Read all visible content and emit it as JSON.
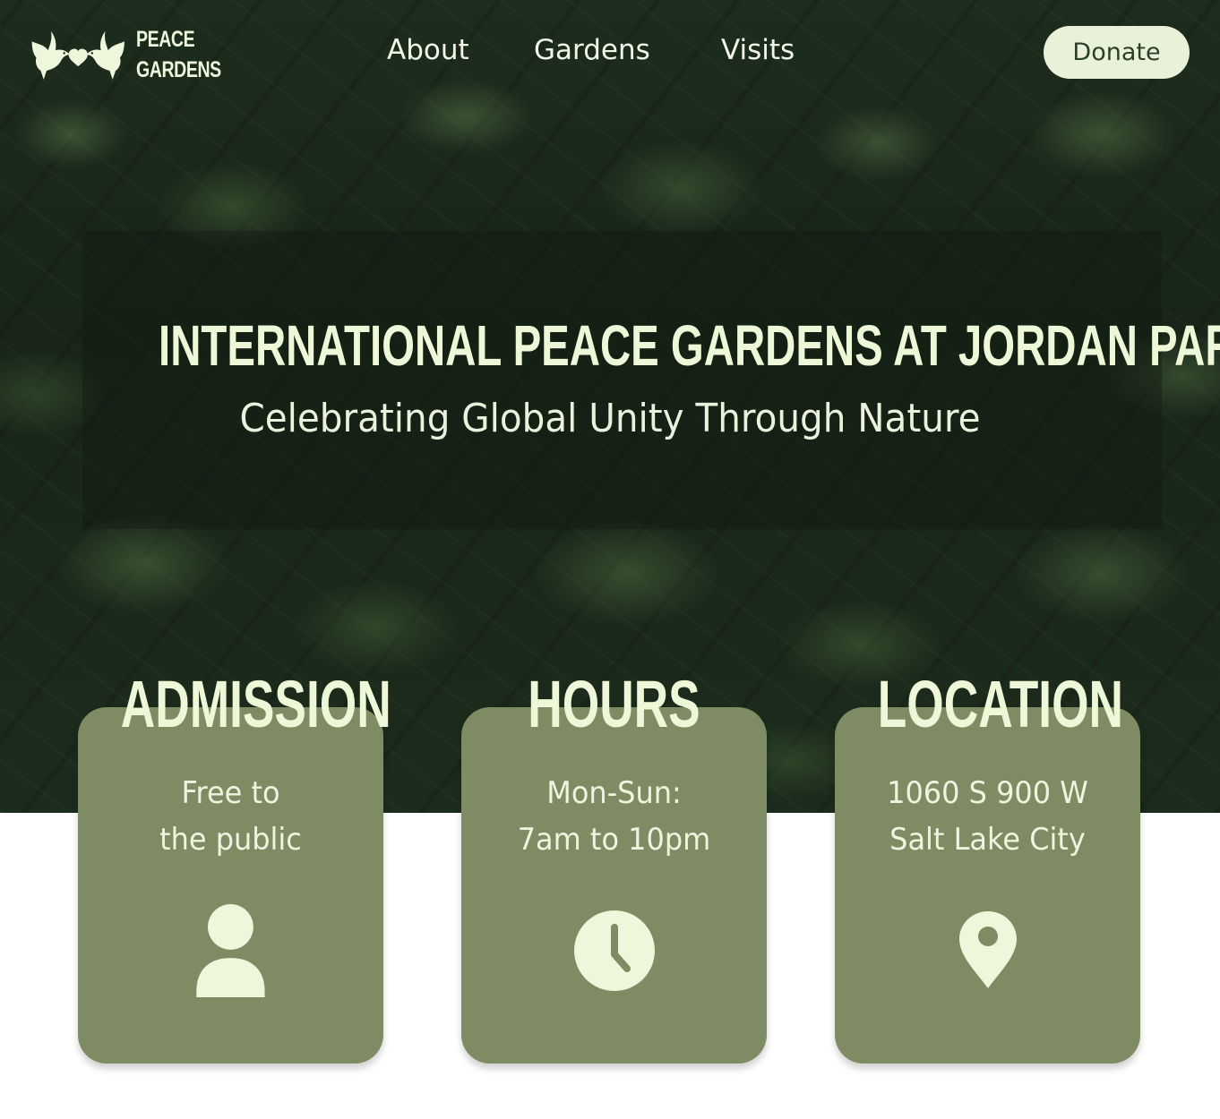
{
  "brand": {
    "logo_line1": "PEACE",
    "logo_line2": "GARDENS",
    "logo_icon": "two-doves-heart-icon"
  },
  "nav": {
    "items": [
      {
        "label": "About"
      },
      {
        "label": "Gardens"
      },
      {
        "label": "Visits"
      }
    ],
    "donate_label": "Donate"
  },
  "hero": {
    "title": "INTERNATIONAL PEACE GARDENS AT JORDAN PARK",
    "subtitle": "Celebrating Global Unity Through Nature"
  },
  "cards": [
    {
      "heading": "ADMISSION",
      "line1": "Free to",
      "line2": "the public",
      "icon": "person-icon"
    },
    {
      "heading": "HOURS",
      "line1": "Mon-Sun:",
      "line2": "7am to 10pm",
      "icon": "clock-icon"
    },
    {
      "heading": "LOCATION",
      "line1": "1060 S 900 W",
      "line2": "Salt Lake City",
      "icon": "map-pin-icon"
    }
  ],
  "colors": {
    "hero_dark_green": "#1c2c1c",
    "card_green": "#7f8b62",
    "text_light": "#eef7d8",
    "donate_bg": "#e9f2d8",
    "donate_text": "#2d3f2a"
  }
}
